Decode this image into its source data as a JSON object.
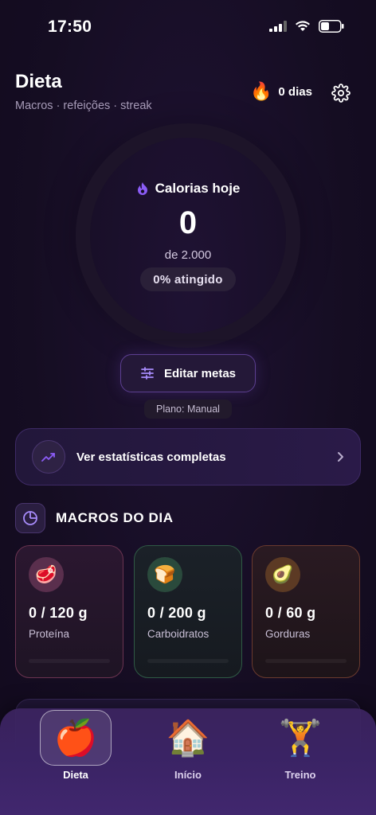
{
  "status_bar": {
    "time": "17:50"
  },
  "header": {
    "title": "Dieta",
    "subtitle": "Macros · refeições · streak"
  },
  "streak": {
    "icon": "fire-icon",
    "label": "0 dias"
  },
  "calories": {
    "label": "Calorias hoje",
    "value": "0",
    "of": "de 2.000",
    "percent": "0% atingido",
    "progress": 0
  },
  "goals": {
    "edit_label": "Editar metas",
    "plan_label": "Plano: Manual"
  },
  "stats": {
    "label": "Ver estatísticas completas"
  },
  "macros": {
    "title": "MACROS DO DIA",
    "items": [
      {
        "name": "Proteína",
        "value": "0 / 120 g",
        "emoji": "🥩",
        "progress": 0
      },
      {
        "name": "Carboidratos",
        "value": "0 / 200 g",
        "emoji": "🍞",
        "progress": 0
      },
      {
        "name": "Gorduras",
        "value": "0 / 60 g",
        "emoji": "🥑",
        "progress": 0
      }
    ]
  },
  "nav": {
    "items": [
      {
        "label": "Dieta",
        "emoji": "🍎",
        "active": true
      },
      {
        "label": "Início",
        "emoji": "🏠",
        "active": false
      },
      {
        "label": "Treino",
        "emoji": "🏋️",
        "active": false
      }
    ]
  },
  "colors": {
    "accent": "#8b5cf6",
    "background": "#150d22",
    "protein": "#6a3350",
    "carbs": "#2f5a45",
    "fat": "#6a3a2e"
  }
}
